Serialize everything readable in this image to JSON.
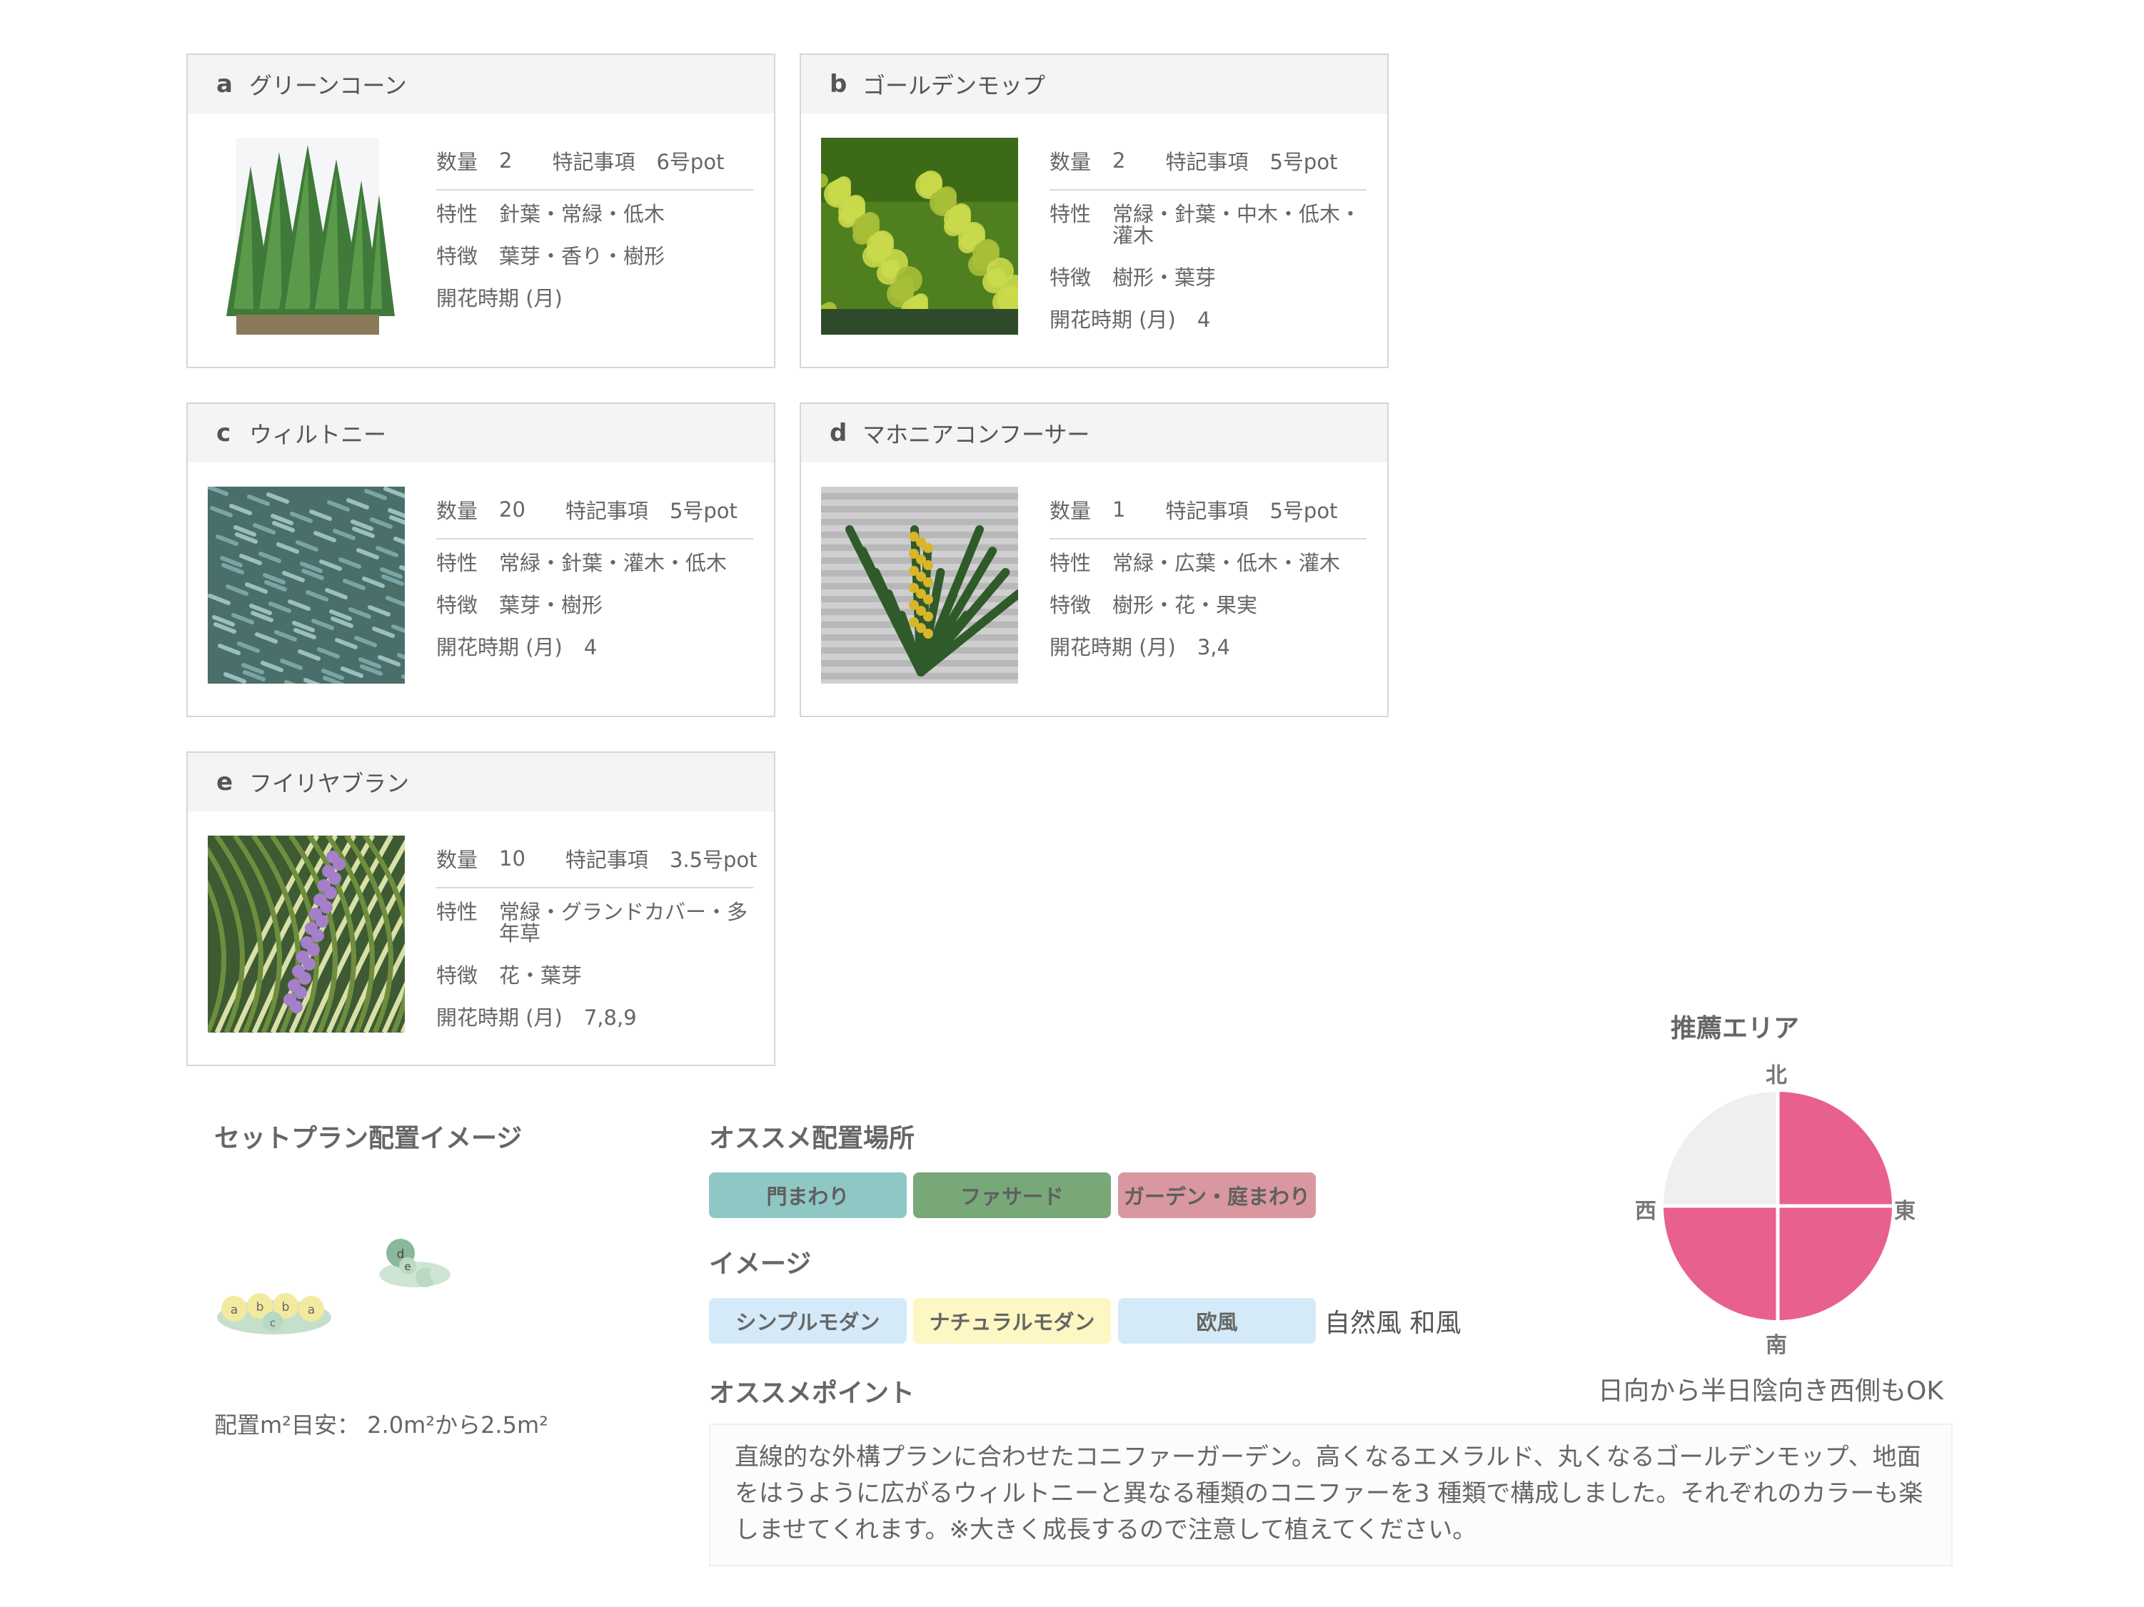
{
  "cards": [
    {
      "letter": "a",
      "name": "グリーンコーン",
      "qty_label": "数量",
      "qty": "2",
      "note_label": "特記事項",
      "note": "6号pot",
      "trait_label": "特性",
      "traits": "針葉・常緑・低木",
      "feature_label": "特徴",
      "features": "葉芽・香り・樹形",
      "bloom_label": "開花時期 (月)",
      "bloom": "",
      "photo_icon": "conifer-trees-photo"
    },
    {
      "letter": "b",
      "name": "ゴールデンモップ",
      "qty_label": "数量",
      "qty": "2",
      "note_label": "特記事項",
      "note": "5号pot",
      "trait_label": "特性",
      "traits": "常緑・針葉・中木・低木・灌木",
      "feature_label": "特徴",
      "features": "樹形・葉芽",
      "bloom_label": "開花時期 (月)",
      "bloom": "4",
      "photo_icon": "golden-mop-photo"
    },
    {
      "letter": "c",
      "name": "ウィルトニー",
      "qty_label": "数量",
      "qty": "20",
      "note_label": "特記事項",
      "note": "5号pot",
      "trait_label": "特性",
      "traits": "常緑・針葉・灌木・低木",
      "feature_label": "特徴",
      "features": "葉芽・樹形",
      "bloom_label": "開花時期 (月)",
      "bloom": "4",
      "photo_icon": "wiltonii-photo"
    },
    {
      "letter": "d",
      "name": "マホニアコンフーサー",
      "qty_label": "数量",
      "qty": "1",
      "note_label": "特記事項",
      "note": "5号pot",
      "trait_label": "特性",
      "traits": "常緑・広葉・低木・灌木",
      "feature_label": "特徴",
      "features": "樹形・花・果実",
      "bloom_label": "開花時期 (月)",
      "bloom": "3,4",
      "photo_icon": "mahonia-photo"
    },
    {
      "letter": "e",
      "name": "フイリヤブラン",
      "qty_label": "数量",
      "qty": "10",
      "note_label": "特記事項",
      "note": "3.5号pot",
      "trait_label": "特性",
      "traits": "常緑・グランドカバー・多年草",
      "feature_label": "特徴",
      "features": "花・葉芽",
      "bloom_label": "開花時期 (月)",
      "bloom": "7,8,9",
      "photo_icon": "liriope-photo"
    }
  ],
  "layout_image": {
    "title": "セットプラン配置イメージ",
    "area_text": "配置m²目安： 2.0m²から2.5m²",
    "labels": [
      "a",
      "b",
      "b",
      "a",
      "c",
      "d",
      "e"
    ]
  },
  "placement": {
    "title": "オススメ配置場所",
    "tags": [
      "門まわり",
      "ファサード",
      "ガーデン・庭まわり"
    ],
    "colors": [
      "#8fc7c5",
      "#78a878",
      "#d9979f"
    ]
  },
  "image_section": {
    "title": "イメージ",
    "tags": [
      "シンプルモダン",
      "ナチュラルモダン",
      "欧風"
    ],
    "extra": "自然風 和風",
    "colors": [
      "#d4eaf8",
      "#fdf7c3",
      "#d4eaf8"
    ]
  },
  "point": {
    "title": "オススメポイント",
    "text": "直線的な外構プランに合わせたコニファーガーデン。高くなるエメラルド、丸くなるゴールデンモップ、地面をはうように広がるウィルトニーと異なる種類のコニファーを3 種類で構成しました。それぞれのカラーも楽しませてくれます。※大きく成長するので注意して植えてください。"
  },
  "area": {
    "title": "推薦エリア",
    "north": "北",
    "east": "東",
    "south": "南",
    "west": "西",
    "note": "日向から半日陰向き西側もOK",
    "quadrants": [
      {
        "name": "north-east",
        "recommended": true
      },
      {
        "name": "south-east",
        "recommended": true
      },
      {
        "name": "south-west",
        "recommended": true
      },
      {
        "name": "north-west",
        "recommended": false
      }
    ],
    "on_color": "#e8608f",
    "off_color": "#efefef"
  }
}
